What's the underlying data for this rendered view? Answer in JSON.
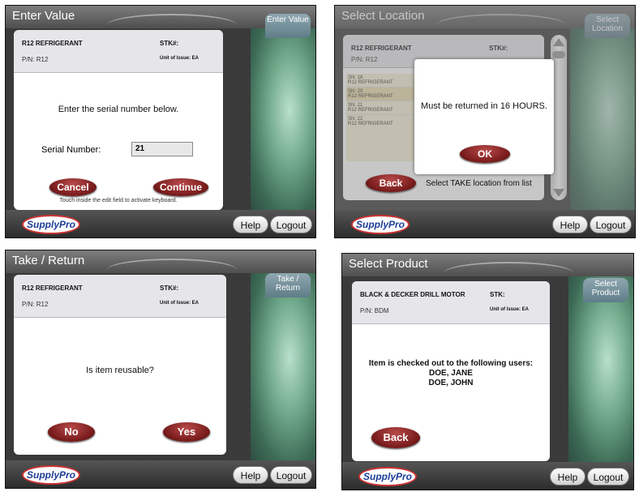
{
  "common": {
    "help_label": "Help",
    "logout_label": "Logout",
    "logo_text": "SupplyPro"
  },
  "screen1": {
    "title": "Enter Value",
    "mode_tab": "Enter Value",
    "item_name": "R12 REFRIGERANT",
    "stk_label": "STK#:",
    "pn": "P/N: R12",
    "unit_of_issue": "Unit of Issue: EA",
    "instruction": "Enter the serial number below.",
    "serial_label": "Serial Number:",
    "serial_value": "21",
    "cancel_label": "Cancel",
    "continue_label": "Continue",
    "hint": "Touch inside the edit field to activate keyboard."
  },
  "screen2": {
    "title": "Select Location",
    "mode_tab": "Select Location",
    "item_name": "R12 REFRIGERANT",
    "stk_label": "STK#:",
    "pn": "P/N: R12",
    "list": [
      {
        "sn": "SN: 18",
        "name": "R12 REFRIGERANT"
      },
      {
        "sn": "SN: 20",
        "name": "R12 REFRIGERANT"
      },
      {
        "sn": "SN: 21",
        "name": "R12 REFRIGERANT"
      },
      {
        "sn": "SN: 22",
        "name": "R12 REFRIGERANT"
      }
    ],
    "dialog_message": "Must be returned in 16 HOURS.",
    "ok_label": "OK",
    "back_label": "Back",
    "status": "Select TAKE location from list"
  },
  "screen3": {
    "title": "Take / Return",
    "mode_tab": "Take / Return",
    "item_name": "R12 REFRIGERANT",
    "stk_label": "STK#:",
    "pn": "P/N: R12",
    "unit_of_issue": "Unit of Issue: EA",
    "question": "Is item reusable?",
    "no_label": "No",
    "yes_label": "Yes"
  },
  "screen4": {
    "title": "Select Product",
    "mode_tab": "Select Product",
    "item_name": "BLACK & DECKER DRILL MOTOR",
    "stk_label": "STK:",
    "pn": "P/N: BDM",
    "unit_of_issue": "Unit of Issue: EA",
    "message": "Item is checked out to the following users:",
    "users": [
      "DOE, JANE",
      "DOE, JOHN"
    ],
    "back_label": "Back"
  }
}
